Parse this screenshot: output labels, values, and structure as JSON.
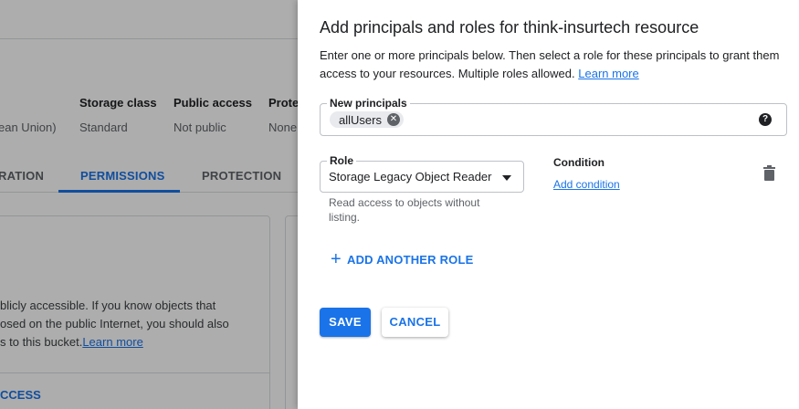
{
  "background": {
    "columns": [
      {
        "header": "",
        "value": "ean Union)"
      },
      {
        "header": "Storage class",
        "value": "Standard"
      },
      {
        "header": "Public access",
        "value": "Not public"
      },
      {
        "header": "Prote",
        "value": "None"
      }
    ],
    "tabs": [
      {
        "label": "RATION"
      },
      {
        "label": "PERMISSIONS"
      },
      {
        "label": "PROTECTION"
      }
    ],
    "card_lines": [
      "blicly accessible. If you know objects that",
      "osed on the public Internet, you should also",
      "s to this bucket."
    ],
    "card_link": "Learn more",
    "access_button": "CCESS"
  },
  "panel": {
    "title": "Add principals and roles for think-insurtech resource",
    "description": "Enter one or more principals below. Then select a role for these principals to grant them access to your resources. Multiple roles allowed.",
    "learn_more": "Learn more",
    "principals": {
      "label": "New principals",
      "chips": [
        "allUsers"
      ]
    },
    "role": {
      "label": "Role",
      "value": "Storage Legacy Object Reader",
      "help": "Read access to objects without listing."
    },
    "condition": {
      "label": "Condition",
      "add": "Add condition"
    },
    "add_another_role": "ADD ANOTHER ROLE",
    "save": "SAVE",
    "cancel": "CANCEL"
  },
  "colors": {
    "accent": "#1a73e8",
    "scrim": "rgba(0,0,0,0.32)"
  }
}
